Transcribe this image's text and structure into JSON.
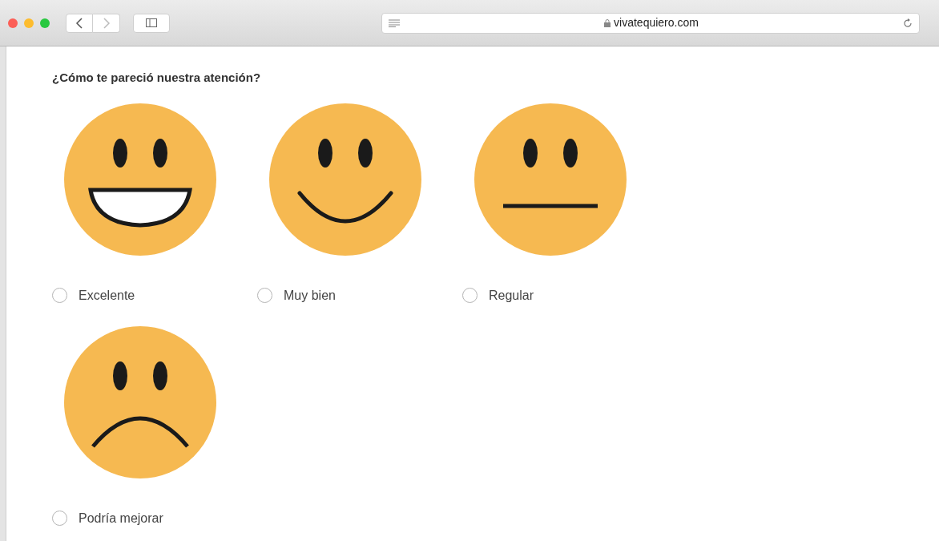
{
  "browser": {
    "address": "vivatequiero.com"
  },
  "question": "¿Cómo te pareció nuestra atención?",
  "options": [
    {
      "label": "Excelente",
      "kind": "grin",
      "selected": false
    },
    {
      "label": "Muy bien",
      "kind": "smile",
      "selected": false
    },
    {
      "label": "Regular",
      "kind": "neutral",
      "selected": false
    },
    {
      "label": "Podría mejorar",
      "kind": "frown",
      "selected": false
    }
  ]
}
